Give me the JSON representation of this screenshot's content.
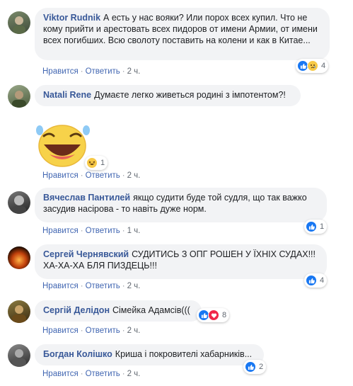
{
  "comments": [
    {
      "author": "Viktor Rudnik",
      "text": "А есть у нас вояки? Или порох всех купил. Что не кому прийти и арестовать всех пидоров от имени Армии, от имени всех погибших. Всю сволоту поставить на колени и как в Китае...",
      "like": "Нравится",
      "reply": "Ответить",
      "time": "2 ч.",
      "reactions": "4"
    },
    {
      "author": "Natali Rene",
      "text": "Думаєте легко живеться родині з імпотентом?!",
      "like": "Нравится",
      "reply": "Ответить",
      "time": "2 ч.",
      "reactions": "1"
    },
    {
      "author": "Вячеслав Пантилей",
      "text": "якщо судити буде той судля, що так важко засудив насірова - то навіть дуже норм.",
      "like": "Нравится",
      "reply": "Ответить",
      "time": "1 ч.",
      "reactions": "1"
    },
    {
      "author": "Сергей Чернявский",
      "text": "СУДИТИСЬ З ОПГ РОШЕН У ЇХНІХ СУДАХ!!! ХА-ХА-ХА БЛЯ ПИЗДЕЦЬ!!!",
      "like": "Нравится",
      "reply": "Ответить",
      "time": "2 ч.",
      "reactions": "4"
    },
    {
      "author": "Сергій Делідон",
      "text": "Сімейка Адамсів(((",
      "like": "Нравится",
      "reply": "Ответить",
      "time": "2 ч.",
      "reactions": "8"
    },
    {
      "author": "Богдан Колішко",
      "text": "Криша і покровителі хабарників...",
      "like": "Нравится",
      "reply": "Ответить",
      "time": "2 ч.",
      "reactions": "2"
    }
  ],
  "colors": {
    "author": "#385898",
    "link": "#4267b2",
    "bubble": "#f2f3f5",
    "like": "#1877f2",
    "love": "#f0284a",
    "haha": "#f7c947"
  },
  "icons": [
    "like-icon",
    "love-icon",
    "haha-icon",
    "sad-icon",
    "laughing-sticker"
  ]
}
